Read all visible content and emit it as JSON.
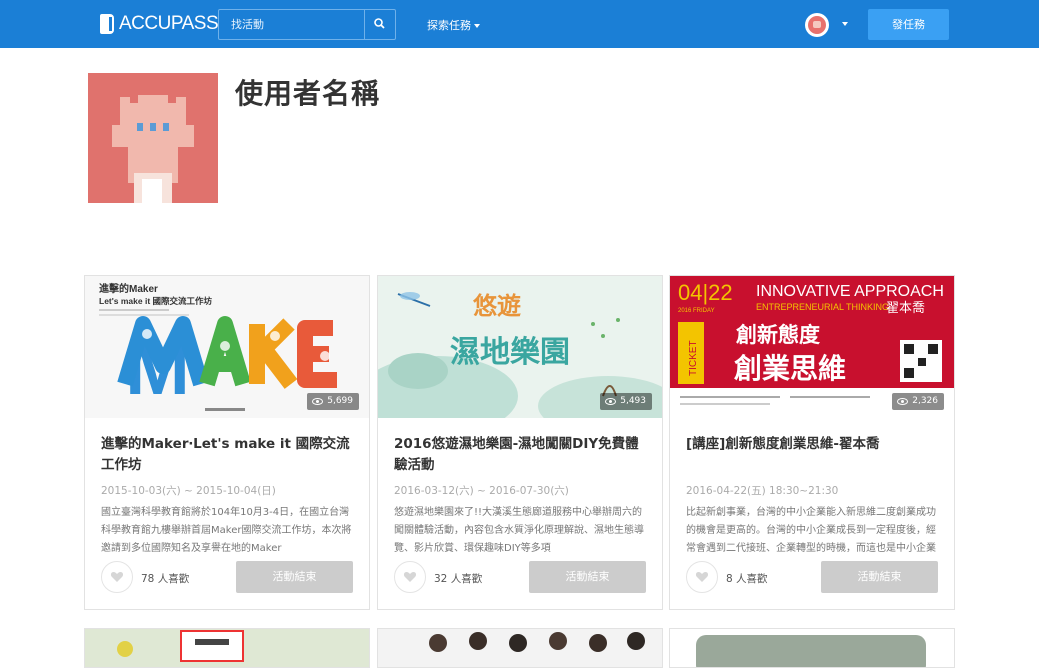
{
  "app": {
    "logo_text": "ACCUPASS"
  },
  "search": {
    "placeholder": "找活動"
  },
  "nav": {
    "explore_label": "探索任務",
    "post_button": "發任務"
  },
  "profile": {
    "name": "使用者名稱"
  },
  "cards": [
    {
      "title": "進擊的Maker‧Let's make it 國際交流工作坊",
      "date": "2015-10-03(六) ~ 2015-10-04(日)",
      "description": "國立臺灣科學教育館將於104年10月3-4日，在國立台灣科學教育館九樓舉辦首屆Maker國際交流工作坊，本次將邀請到多位國際知名及享譽在地的Maker",
      "views": "5,699",
      "likes": "78 人喜歡",
      "status": "活動結束",
      "banner_text": [
        "進擊的Maker",
        "Let's make it 國際交流工作坊",
        "MAKE"
      ]
    },
    {
      "title": "2016悠遊濕地樂園-濕地闖關DIY免費體驗活動",
      "date": "2016-03-12(六) ~ 2016-07-30(六)",
      "description": "悠遊濕地樂園來了!!大漢溪生態廊道服務中心舉辦周六的闖關體驗活動，內容包含水質淨化原理解說、濕地生態導覽、影片欣賞、環保趣味DIY等多項",
      "views": "5,493",
      "likes": "32 人喜歡",
      "status": "活動結束",
      "banner_text": [
        "悠遊",
        "濕地樂園"
      ]
    },
    {
      "title": "[講座]創新態度創業思維-翟本喬",
      "date": "2016-04-22(五) 18:30~21:30",
      "description": "比起新創事業，台灣的中小企業能入新思維二度創業成功的機會是更高的。台灣的中小企業成長到一定程度後，經常會遇到二代接班、企業轉型的時機，而這也是中小企業轉向做大的契機。在本次的",
      "views": "2,326",
      "likes": "8 人喜歡",
      "status": "活動結束",
      "banner_text": [
        "04|22",
        "INNOVATIVE APPROACH",
        "ENTREPRENEURIAL THINKING",
        "翟本喬",
        "創新態度",
        "創業思維",
        "TICKET",
        "2016 FRIDAY"
      ]
    }
  ],
  "colors": {
    "brand": "#1b7fd6",
    "post_button": "#3aa0f3",
    "avatar": "#e0726d",
    "ended": "#cccccc"
  }
}
